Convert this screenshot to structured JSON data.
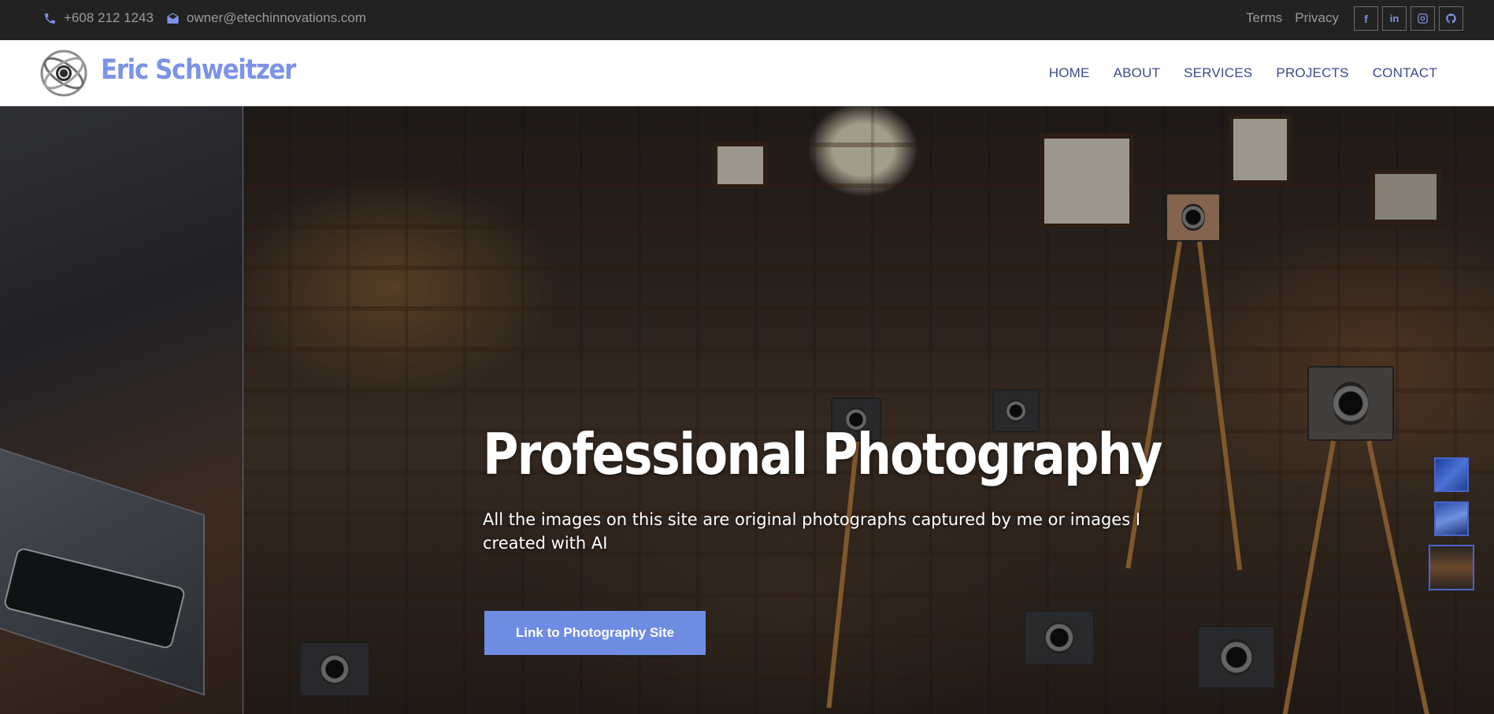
{
  "topbar": {
    "phone": "+608 212 1243",
    "email": "owner@etechinnovations.com",
    "links": [
      "Terms",
      "Privacy"
    ],
    "social": [
      {
        "icon": "facebook-icon",
        "glyph": "f"
      },
      {
        "icon": "linkedin-icon",
        "glyph": "in"
      },
      {
        "icon": "instagram-icon",
        "glyph": ""
      },
      {
        "icon": "github-icon",
        "glyph": ""
      }
    ]
  },
  "header": {
    "brand": "Eric Schweitzer",
    "nav": [
      "HOME",
      "ABOUT",
      "SERVICES",
      "PROJECTS",
      "CONTACT"
    ]
  },
  "hero": {
    "title": "Professional Photography",
    "subtitle": "All the images on this site are original photographs captured by me or images I created with AI",
    "button": "Link to Photography Site"
  },
  "colors": {
    "accent": "#7b93e8",
    "button": "#6f8ce3",
    "topbar": "#222222",
    "nav_text": "#3b4b8c"
  }
}
